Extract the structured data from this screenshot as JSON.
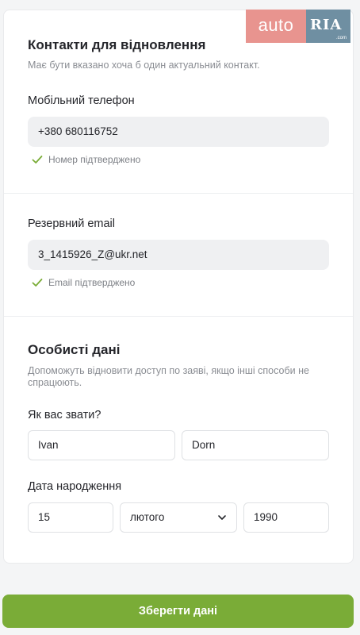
{
  "contacts": {
    "title": "Контакти для відновлення",
    "hint": "Має бути вказано хоча б один актуальний контакт.",
    "phone_label": "Мобільний телефон",
    "phone_value": "+380 680116752",
    "phone_status": "Номер підтверджено",
    "email_label": "Резервний email",
    "email_value": "3_1415926_Z@ukr.net",
    "email_status": "Email підтверджено"
  },
  "personal": {
    "title": "Особисті дані",
    "hint": "Допоможуть відновити доступ по заяві, якщо інші способи не спрацюють.",
    "name_label": "Як вас звати?",
    "first_name": "Ivan",
    "last_name": "Dorn",
    "birth_label": "Дата народження",
    "birth_day": "15",
    "birth_month": "лютого",
    "birth_year": "1990"
  },
  "save_label": "Зберегти дані",
  "logo": {
    "auto": "auto",
    "ria": "RIA",
    "com": ".com"
  },
  "colors": {
    "accent": "#7aac37",
    "check": "#7aac37",
    "logo_auto": "#e8948f",
    "logo_ria": "#6f8fa2"
  },
  "icons": {
    "verified": "check-icon",
    "dropdown": "chevron-down-icon"
  }
}
